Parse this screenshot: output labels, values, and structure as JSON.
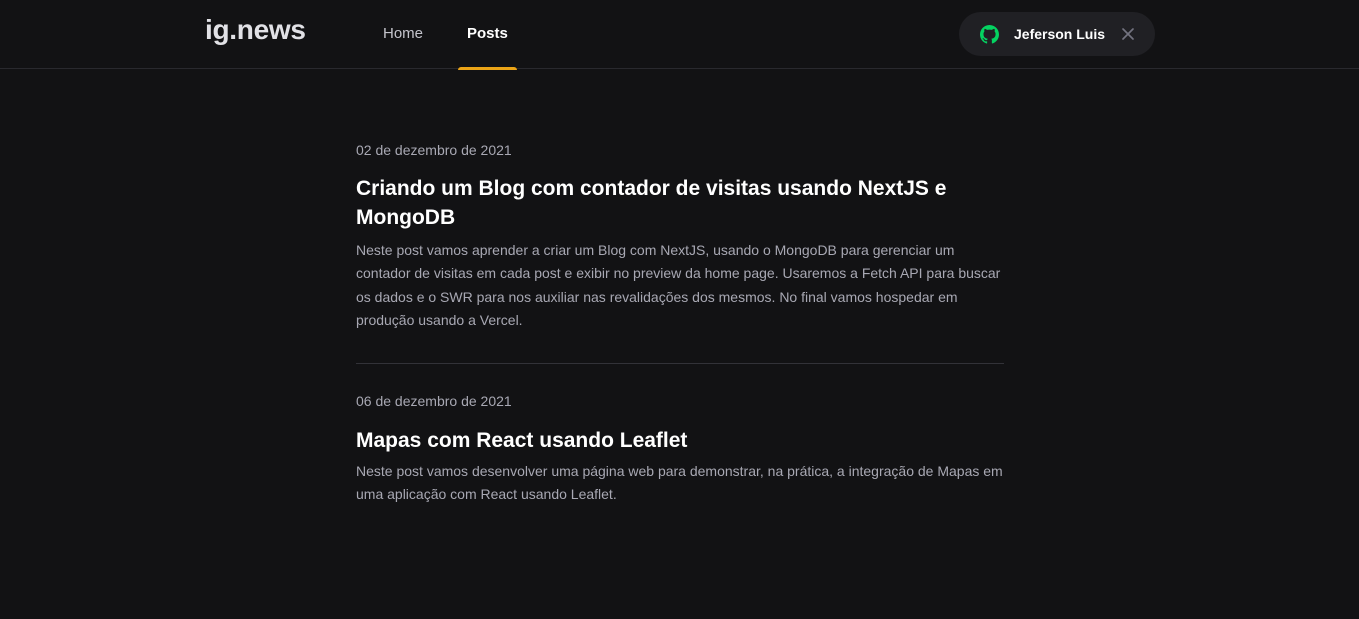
{
  "header": {
    "logo": "ig.news",
    "nav": [
      {
        "label": "Home",
        "active": false
      },
      {
        "label": "Posts",
        "active": true
      }
    ],
    "user": {
      "name": "Jeferson Luis",
      "icon": "github-icon",
      "close_icon": "close-icon"
    }
  },
  "colors": {
    "background": "#121214",
    "header_border": "#29292e",
    "accent": "#eba417",
    "github_green": "#04d361",
    "button_bg": "#202024"
  },
  "posts": [
    {
      "date": "02 de dezembro de 2021",
      "title": "Criando um Blog com contador de visitas usando NextJS e MongoDB",
      "excerpt": "Neste post vamos aprender a criar um Blog com NextJS, usando o MongoDB para gerenciar um contador de visitas em cada post e exibir no preview da home page. Usaremos a Fetch API para buscar os dados e o SWR para nos auxiliar nas revalidações dos mesmos. No final vamos hospedar em produção usando a Vercel."
    },
    {
      "date": "06 de dezembro de 2021",
      "title": "Mapas com React usando Leaflet",
      "excerpt": "Neste post vamos desenvolver uma página web para demonstrar, na prática, a integração de Mapas em uma aplicação com React usando Leaflet."
    }
  ]
}
